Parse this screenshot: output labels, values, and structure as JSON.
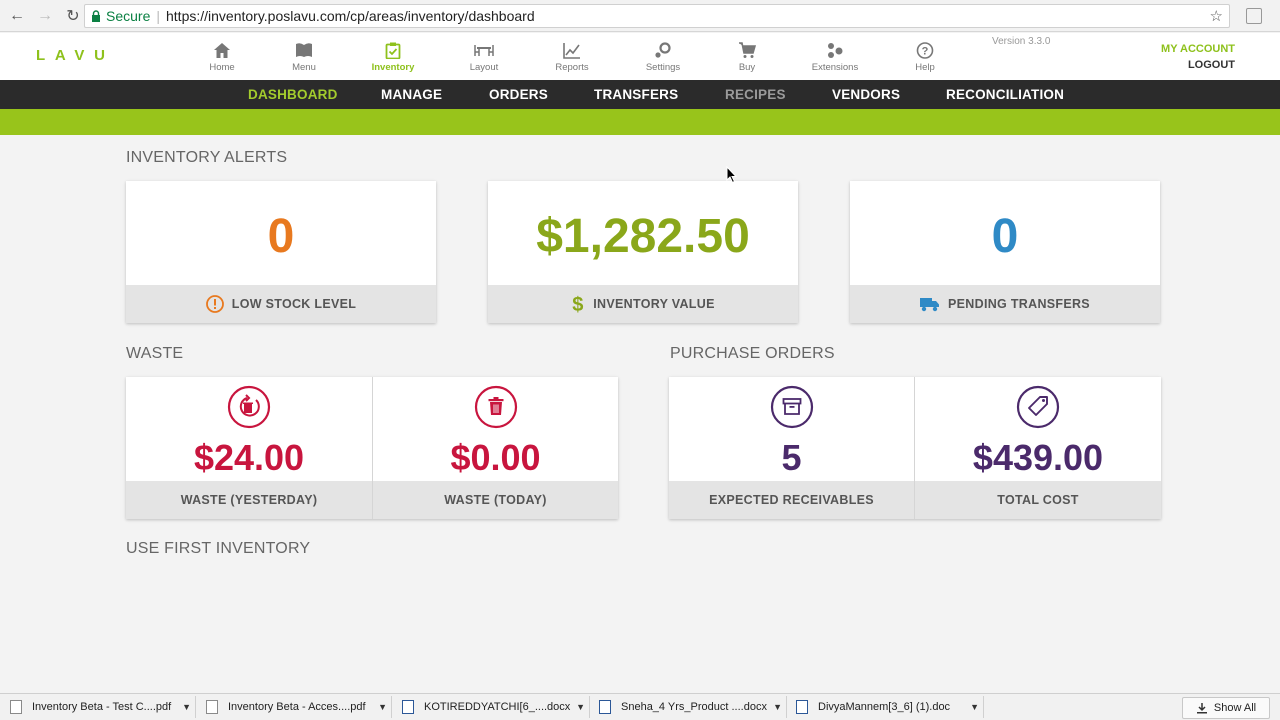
{
  "browser": {
    "secure_label": "Secure",
    "url": "https://inventory.poslavu.com/cp/areas/inventory/dashboard"
  },
  "header": {
    "logo_text": "LAVU",
    "version": "Version 3.3.0",
    "my_account": "MY ACCOUNT",
    "logout": "LOGOUT",
    "nav": [
      {
        "label": "Home",
        "icon": "home-icon"
      },
      {
        "label": "Menu",
        "icon": "book-icon"
      },
      {
        "label": "Inventory",
        "icon": "clipboard-icon",
        "active": true
      },
      {
        "label": "Layout",
        "icon": "table-icon"
      },
      {
        "label": "Reports",
        "icon": "chart-icon"
      },
      {
        "label": "Settings",
        "icon": "gear-icon"
      },
      {
        "label": "Buy",
        "icon": "cart-icon"
      },
      {
        "label": "Extensions",
        "icon": "extensions-icon"
      },
      {
        "label": "Help",
        "icon": "help-icon"
      }
    ]
  },
  "subnav": {
    "items": [
      "DASHBOARD",
      "MANAGE",
      "ORDERS",
      "TRANSFERS",
      "RECIPES",
      "VENDORS",
      "RECONCILIATION"
    ],
    "active": "DASHBOARD"
  },
  "alerts": {
    "title": "INVENTORY ALERTS",
    "low_stock": {
      "value": "0",
      "label": "LOW STOCK LEVEL"
    },
    "inventory_value": {
      "value": "$1,282.50",
      "label": "INVENTORY VALUE"
    },
    "pending_transfers": {
      "value": "0",
      "label": "PENDING TRANSFERS"
    }
  },
  "waste": {
    "title": "WASTE",
    "yesterday": {
      "value": "$24.00",
      "label": "WASTE (YESTERDAY)"
    },
    "today": {
      "value": "$0.00",
      "label": "WASTE (TODAY)"
    }
  },
  "purchase_orders": {
    "title": "PURCHASE ORDERS",
    "expected": {
      "value": "5",
      "label": "EXPECTED RECEIVABLES"
    },
    "total_cost": {
      "value": "$439.00",
      "label": "TOTAL COST"
    }
  },
  "use_first": {
    "title": "USE FIRST INVENTORY"
  },
  "downloads": {
    "items": [
      "Inventory Beta - Test C....pdf",
      "Inventory Beta - Acces....pdf",
      "KOTIREDDYATCHI[6_....docx",
      "Sneha_4 Yrs_Product ....docx",
      "DivyaMannem[3_6] (1).doc"
    ],
    "show_all": "Show All"
  },
  "colors": {
    "brand_green": "#8ec11c",
    "orange": "#e8791f",
    "olive": "#8aa71a",
    "blue": "#2f8ac6",
    "crimson": "#c8153e",
    "purple": "#4b2a6b"
  }
}
